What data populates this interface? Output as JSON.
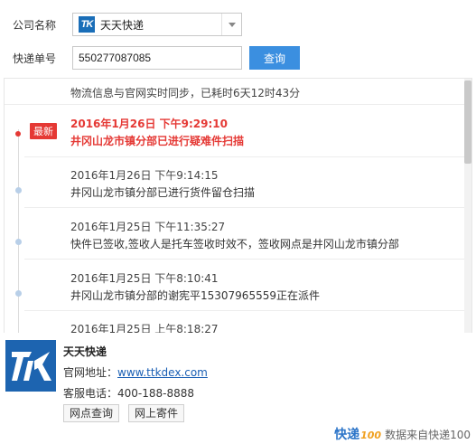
{
  "form": {
    "company_label": "公司名称",
    "company_value": "天天快递",
    "company_logo_text": "TK",
    "number_label": "快递单号",
    "number_value": "550277087085",
    "query_label": "查询"
  },
  "tracking": {
    "sync_text": "物流信息与官网实时同步，已耗时6天12时43分",
    "latest_badge": "最新",
    "events": [
      {
        "time": "2016年1月26日 下午9:29:10",
        "desc": "井冈山龙市镇分部已进行疑难件扫描",
        "latest": true
      },
      {
        "time": "2016年1月26日 下午9:14:15",
        "desc": "井冈山龙市镇分部已进行货件留仓扫描"
      },
      {
        "time": "2016年1月25日 下午11:35:27",
        "desc": "快件已签收,签收人是托车签收时效不，签收网点是井冈山龙市镇分部"
      },
      {
        "time": "2016年1月25日 下午8:10:41",
        "desc": "井冈山龙市镇分部的谢宪平15307965559正在派件"
      },
      {
        "time": "2016年1月25日 上午8:18:27",
        "desc": ""
      }
    ]
  },
  "company": {
    "name": "天天快递",
    "site_label": "官网地址：",
    "site_url": "www.ttkdex.com",
    "phone_label": "客服电话：",
    "phone": "400-188-8888",
    "btn_outlet": "网点查询",
    "btn_ship": "网上寄件"
  },
  "source": {
    "logo": "快递",
    "logo_suffix": "100",
    "text": "数据来自快递100"
  },
  "colors": {
    "accent": "#3b8fe0",
    "latest": "#e53935",
    "brand": "#1d64b0"
  }
}
